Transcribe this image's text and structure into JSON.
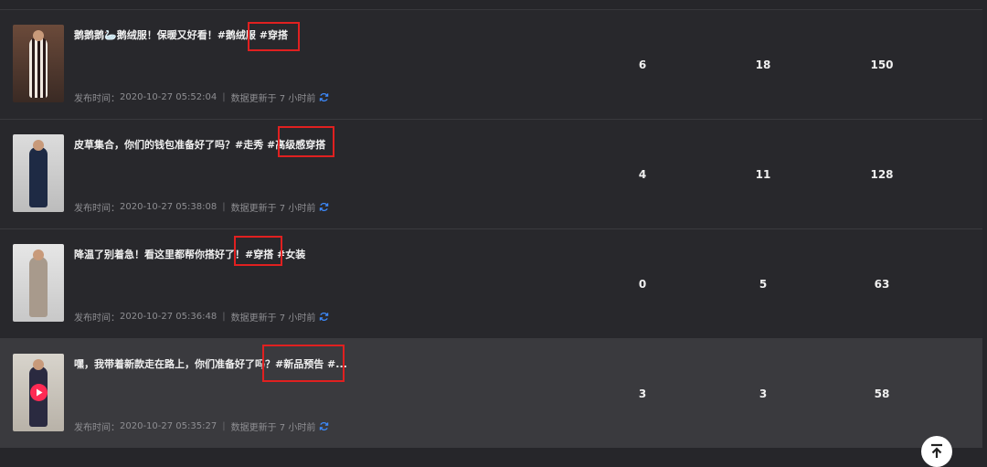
{
  "rows": [
    {
      "title": "鹅鹅鹅🦢鹅绒服！保暖又好看！#鹅绒服 #穿搭",
      "publish_label": "发布时间：",
      "publish_time": "2020-10-27 05:52:04",
      "update_text": "数据更新于 7 小时前",
      "stats": [
        "6",
        "18",
        "150"
      ],
      "has_video": false
    },
    {
      "title": "皮草集合，你们的钱包准备好了吗？#走秀 #高级感穿搭",
      "publish_label": "发布时间：",
      "publish_time": "2020-10-27 05:38:08",
      "update_text": "数据更新于 7 小时前",
      "stats": [
        "4",
        "11",
        "128"
      ],
      "has_video": false
    },
    {
      "title": "降温了别着急！看这里都帮你搭好了！#穿搭 #女装",
      "publish_label": "发布时间：",
      "publish_time": "2020-10-27 05:36:48",
      "update_text": "数据更新于 7 小时前",
      "stats": [
        "0",
        "5",
        "63"
      ],
      "has_video": false
    },
    {
      "title": "嘿，我带着新款走在路上，你们准备好了吗？#新品预告 #...",
      "publish_label": "发布时间：",
      "publish_time": "2020-10-27 05:35:27",
      "update_text": "数据更新于 7 小时前",
      "stats": [
        "3",
        "3",
        "58"
      ],
      "has_video": true
    }
  ],
  "colors": {
    "refresh": "#3d8bff",
    "highlight": "#e02020",
    "play": "#ff2a54"
  },
  "icons": {
    "refresh": "refresh-icon",
    "play": "play-icon",
    "back_to_top": "arrow-up-icon"
  }
}
